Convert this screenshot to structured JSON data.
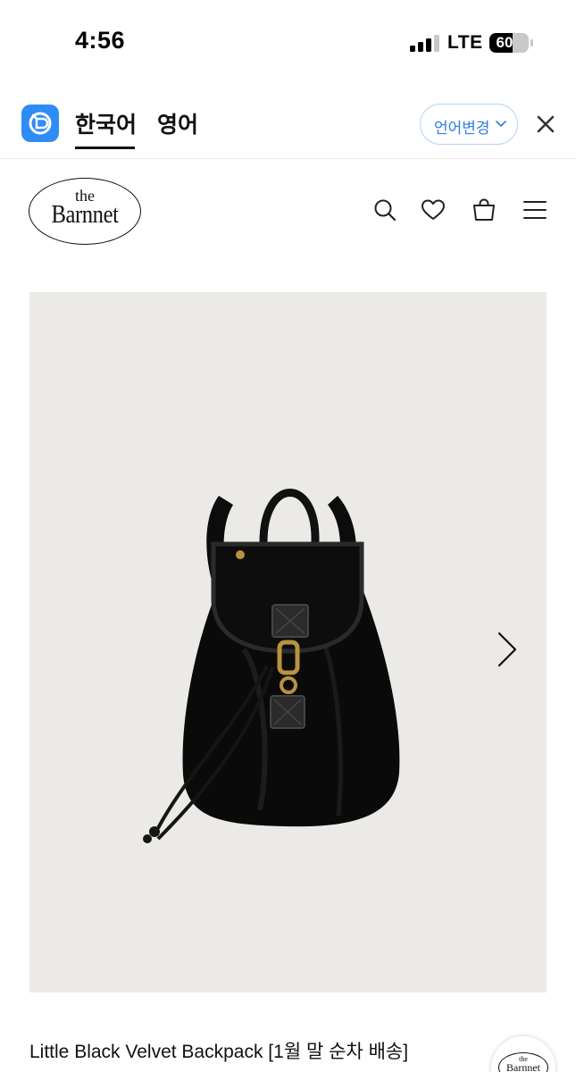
{
  "status_bar": {
    "time": "4:56",
    "network": "LTE",
    "battery_level": "60",
    "battery_fraction": 0.6
  },
  "language_bar": {
    "tabs": [
      {
        "label": "한국어",
        "active": true
      },
      {
        "label": "영어",
        "active": false
      }
    ],
    "change_button_label": "언어변경",
    "accent_color": "#2f8cf4"
  },
  "header": {
    "brand": {
      "the": "the",
      "name": "Barnnet"
    },
    "icons": [
      "search-icon",
      "heart-icon",
      "shopping-bag-icon",
      "menu-icon"
    ]
  },
  "product": {
    "image_alt_icon": "black-velvet-backpack",
    "next_icon": "chevron-right-icon",
    "title": "Little Black Velvet Backpack [1월 말 순차 배송]"
  },
  "floating_badge": {
    "the": "the",
    "name": "Barnnet"
  }
}
